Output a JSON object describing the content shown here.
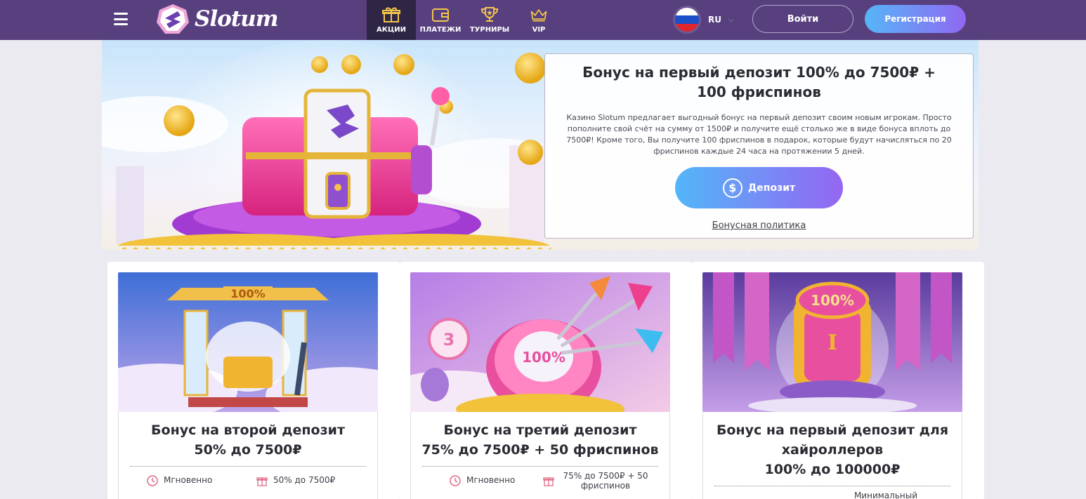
{
  "header": {
    "logo_text": "Slotum",
    "nav": [
      {
        "label": "АКЦИИ",
        "icon": "gift-icon",
        "active": true
      },
      {
        "label": "ПЛАТЕЖИ",
        "icon": "wallet-icon",
        "active": false
      },
      {
        "label": "ТУРНИРЫ",
        "icon": "trophy-icon",
        "active": false
      },
      {
        "label": "VIP",
        "icon": "crown-icon",
        "active": false
      }
    ],
    "language": "RU",
    "login_label": "Войти",
    "register_label": "Регистрация"
  },
  "hero": {
    "title": "Бонус на первый депозит 100% до 7500₽ + 100 фриспинов",
    "description": "Казино Slotum предлагает выгодный бонус на первый депозит своим новым игрокам. Просто пополните свой счёт на сумму от 1500₽ и получите ещё столько же в виде бонуса вплоть до 7500₽! Кроме того, Вы получите 100 фриспинов в подарок, которые будут начисляться по 20 фриспинов каждые 24 часа на протяжении 5 дней.",
    "deposit_label": "Депозит",
    "policy_link": "Бонусная политика"
  },
  "cards": [
    {
      "title_lines": [
        "Бонус на второй депозит",
        "50% до 7500₽"
      ],
      "timing": "Мгновенно",
      "reward": "50% до 7500₽"
    },
    {
      "title_lines": [
        "Бонус на третий депозит",
        "75% до 7500₽ + 50 фриспинов"
      ],
      "timing": "Мгновенно",
      "reward": "75% до 7500₽ + 50 фриспинов"
    },
    {
      "title_lines": [
        "Бонус на первый депозит для",
        "хайроллеров",
        "100% до 100000₽"
      ],
      "timing": "",
      "reward": "Минимальный"
    }
  ],
  "colors": {
    "header": "#58407f",
    "nav_active": "#2f2545",
    "accent_from": "#52b6f9",
    "accent_to": "#9566f2"
  }
}
